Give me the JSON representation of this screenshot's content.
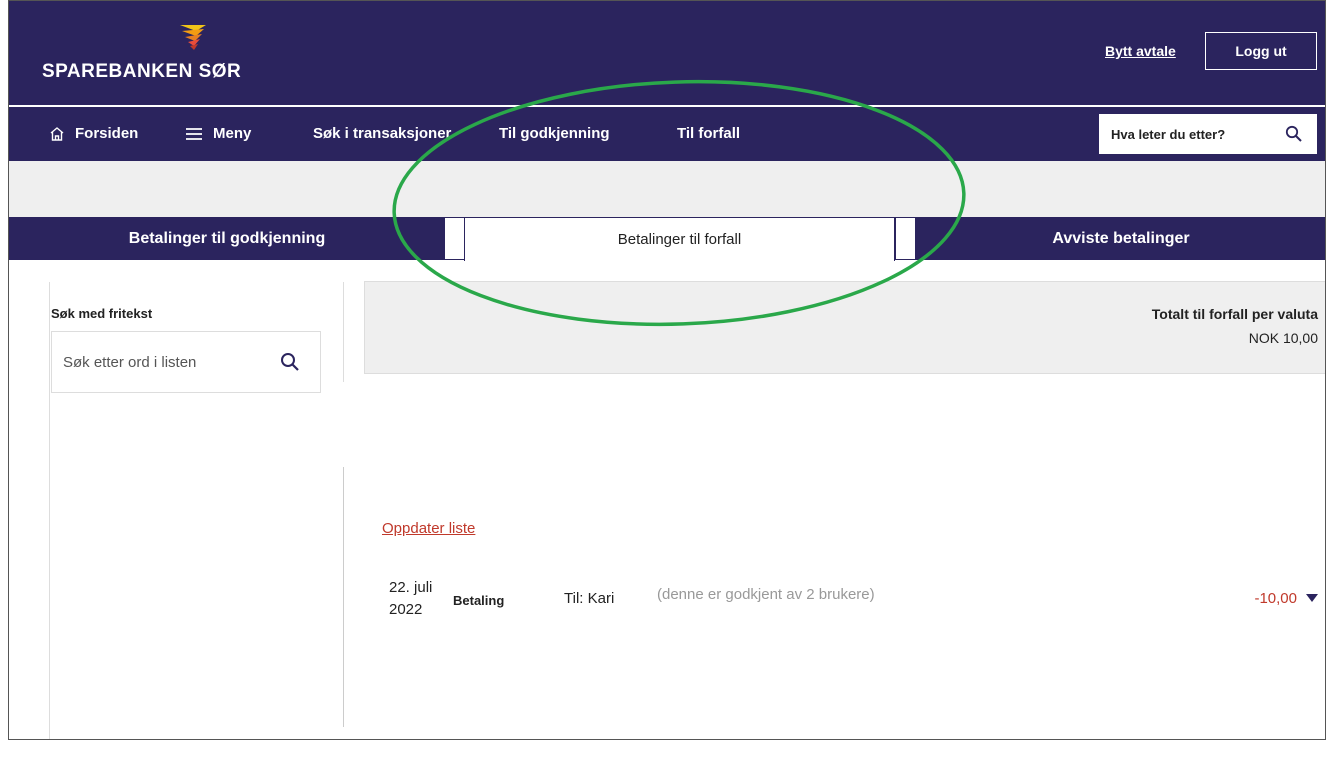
{
  "header": {
    "logo_text": "SPAREBANKEN SØR",
    "switch_agreement": "Bytt avtale",
    "logout": "Logg ut"
  },
  "nav": {
    "home": "Forsiden",
    "menu": "Meny",
    "search_transactions": "Søk i transaksjoner",
    "to_approval": "Til godkjenning",
    "due": "Til forfall",
    "search_placeholder": "Hva leter du etter?"
  },
  "tabs": [
    {
      "label": "Betalinger til godkjenning",
      "active": false
    },
    {
      "label": "Betalinger til forfall",
      "active": true
    },
    {
      "label": "Avviste betalinger",
      "active": false
    }
  ],
  "left_panel": {
    "label": "Søk med fritekst",
    "search_placeholder": "Søk etter ord i listen"
  },
  "totals": {
    "title": "Totalt til forfall per valuta",
    "value": "NOK 10,00"
  },
  "refresh_link": "Oppdater liste",
  "payments": [
    {
      "date": "22. juli 2022",
      "type": "Betaling",
      "recipient": "Til: Kari",
      "note": "(denne er godkjent av 2 brukere)",
      "amount": "-10,00"
    }
  ],
  "colors": {
    "brand": "#2b245e",
    "negative": "#c0392b",
    "annotation": "#2aa84a"
  }
}
